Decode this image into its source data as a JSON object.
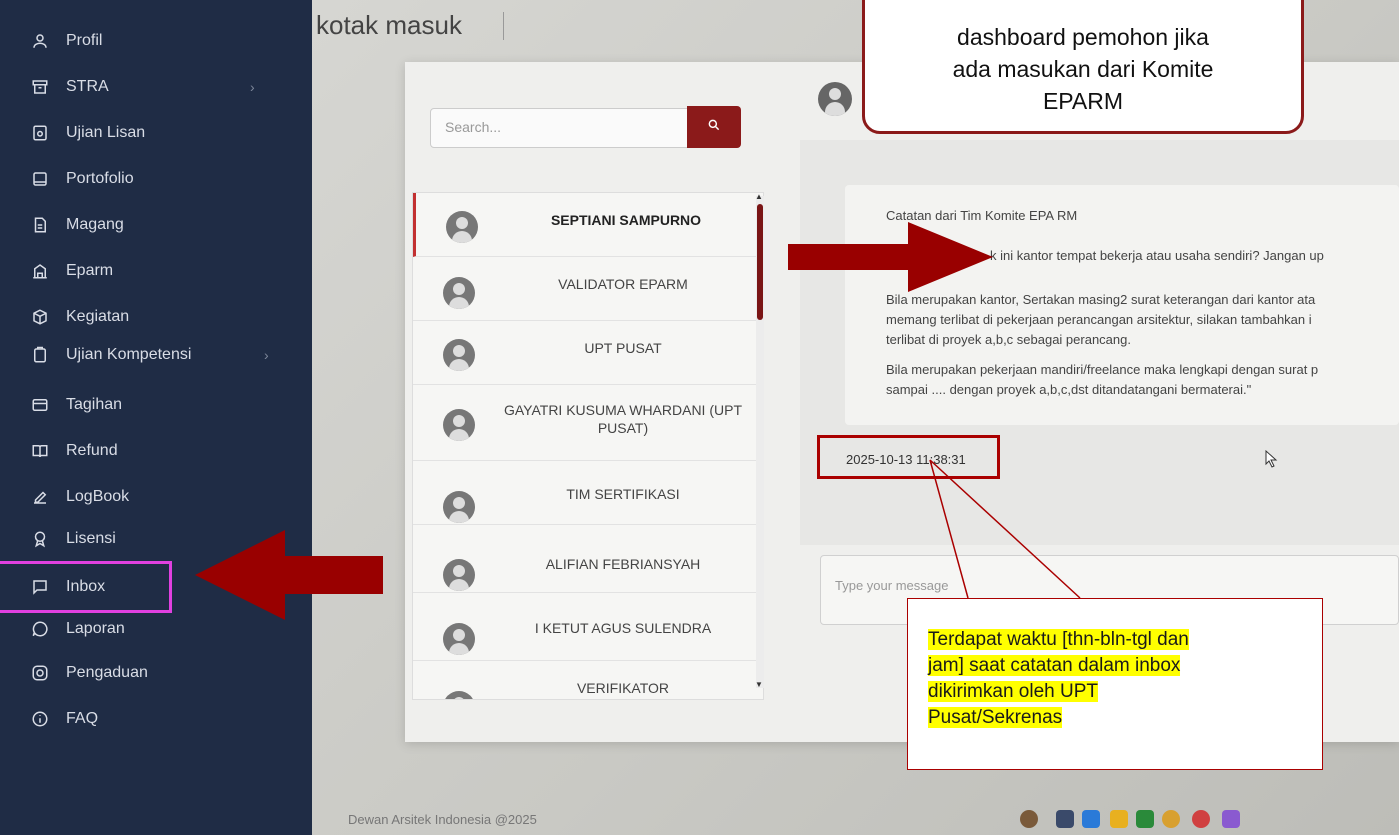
{
  "page": {
    "title": "kotak masuk",
    "footer": "Dewan Arsitek Indonesia @2025"
  },
  "sidebar": {
    "items": [
      {
        "label": "Profil",
        "icon": "user-icon"
      },
      {
        "label": "STRA",
        "icon": "archive-icon",
        "has_submenu": true
      },
      {
        "label": "Ujian Lisan",
        "icon": "exam-icon"
      },
      {
        "label": "Portofolio",
        "icon": "folder-icon"
      },
      {
        "label": "Magang",
        "icon": "document-icon"
      },
      {
        "label": "Eparm",
        "icon": "building-icon"
      },
      {
        "label": "Kegiatan",
        "icon": "package-icon"
      },
      {
        "label": "Ujian Kompetensi",
        "icon": "clipboard-icon",
        "has_submenu": true
      },
      {
        "label": "Tagihan",
        "icon": "card-icon"
      },
      {
        "label": "Refund",
        "icon": "book-icon"
      },
      {
        "label": "LogBook",
        "icon": "edit-icon"
      },
      {
        "label": "Lisensi",
        "icon": "award-icon"
      },
      {
        "label": "Inbox",
        "icon": "message-icon",
        "active": true
      },
      {
        "label": "Laporan",
        "icon": "chat-icon"
      },
      {
        "label": "Pengaduan",
        "icon": "instagram-icon"
      },
      {
        "label": "FAQ",
        "icon": "info-icon"
      }
    ]
  },
  "search": {
    "placeholder": "Search..."
  },
  "contacts": [
    {
      "name": "SEPTIANI SAMPURNO",
      "active": true
    },
    {
      "name": "VALIDATOR EPARM"
    },
    {
      "name": "UPT PUSAT"
    },
    {
      "name": "GAYATRI KUSUMA WHARDANI (UPT PUSAT)"
    },
    {
      "name": "TIM SERTIFIKASI"
    },
    {
      "name": "ALIFIAN FEBRIANSYAH"
    },
    {
      "name": "I KETUT AGUS SULENDRA"
    },
    {
      "name": "VERIFIKATOR"
    }
  ],
  "message": {
    "lines": [
      "Catatan dari Tim Komite EPA RM",
      "k ini kantor tempat bekerja atau usaha sendiri? Jangan up",
      "Bila merupakan kantor, Sertakan masing2 surat keterangan dari kantor ata",
      "memang terlibat di pekerjaan perancangan arsitektur, silakan tambahkan i",
      "terlibat di proyek a,b,c sebagai perancang.",
      "Bila merupakan pekerjaan mandiri/freelance maka lengkapi dengan surat p",
      "sampai .... dengan proyek a,b,c,dst ditandatangani bermaterai.\""
    ],
    "timestamp": "2025-10-13 11:38:31"
  },
  "compose": {
    "placeholder": "Type your message"
  },
  "callouts": {
    "top": [
      "dashboard pemohon jika",
      "ada masukan dari Komite",
      "EPARM"
    ],
    "bottom": [
      "Terdapat waktu [thn-bln-tgl dan",
      "jam] saat catatan dalam inbox",
      "dikirimkan oleh UPT",
      "Pusat/Sekrenas"
    ]
  },
  "colors": {
    "sidebar_bg": "#1f2c45",
    "accent": "#8b1a1a",
    "highlight": "#e040e0",
    "annotation_yellow": "#ffff00"
  }
}
